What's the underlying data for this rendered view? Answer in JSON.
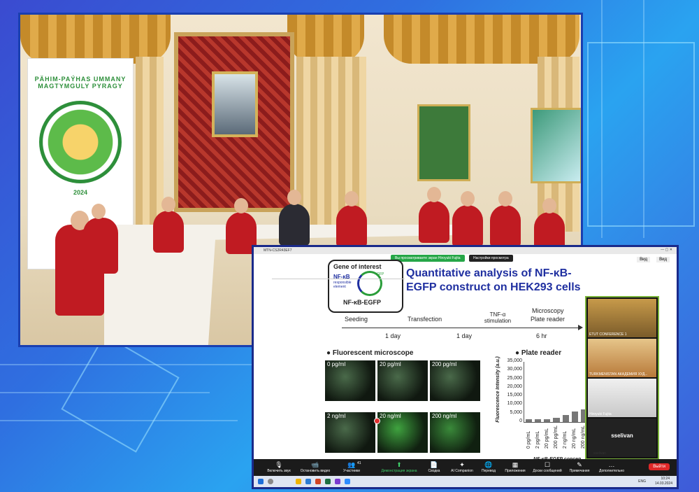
{
  "banner": {
    "text": "PÄHIM-PAÝHAS UMMANY MAGTYMGULY PYRAGY",
    "year": "2024"
  },
  "zoom": {
    "window_title": "MTN-CS2R43EF7",
    "share_banner": "Вы просматриваете экран Hiroyuki Fujita",
    "view_options": "Настройки просмотра",
    "top_right_buttons": [
      "Вид",
      "Вид"
    ]
  },
  "slide": {
    "title": "Quantitative analysis of NF-κB-EGFP construct on HEK293 cells",
    "gene_box": {
      "gene_of_interest": "Gene of interest",
      "nfkb": "NF-κB",
      "responsible": "responsible",
      "element": "element",
      "gfp": "GFP",
      "construct": "NF-κB-EGFP"
    },
    "timeline": {
      "steps": [
        "Seeding",
        "Transfection",
        "TNF-α stimulation",
        "Microscopy",
        "Plate reader"
      ],
      "intervals": [
        "1 day",
        "1 day",
        "6 hr"
      ]
    },
    "fluorescent": {
      "heading": "Fluorescent microscope",
      "labels": [
        "0 pg/ml",
        "20 pg/ml",
        "200 pg/ml",
        "2 ng/ml",
        "20 ng/ml",
        "200 ng/ml"
      ]
    },
    "plate_reader": {
      "heading": "Plate reader"
    }
  },
  "chart_data": {
    "type": "bar",
    "title": "",
    "xlabel": "NF-κB-EGFP concen",
    "ylabel": "Fluorescence Intensity (a.u.)",
    "categories": [
      "0 pg/mL",
      "2 pg/mL",
      "20 pg/mL",
      "200 pg/mL",
      "2 ng/mL",
      "20 ng/mL",
      "200 ng/mL"
    ],
    "values": [
      1500,
      1800,
      1600,
      2600,
      4000,
      6200,
      7500
    ],
    "yticks": [
      "35,000",
      "30,000",
      "25,000",
      "20,000",
      "15,000",
      "10,000",
      "5,000",
      "0"
    ],
    "ylim": [
      0,
      35000
    ]
  },
  "gallery": {
    "tiles": [
      "ETUT CONFERENCE 1",
      "TURKMENISTAN АКАДЕМИЯ ХУД...",
      "Hiroyuki Fujita"
    ],
    "self_name": "sselivan",
    "footer_name": "sselivan"
  },
  "toolbar": {
    "items": [
      {
        "icon": "🎙",
        "label": "Включить звук"
      },
      {
        "icon": "📹",
        "label": "Остановить видео"
      },
      {
        "icon": "👥",
        "label": "Участники",
        "count": "41"
      },
      {
        "icon": "⬆",
        "label": "Демонстрация экрана"
      },
      {
        "icon": "📄",
        "label": "Сводка"
      },
      {
        "icon": "✦",
        "label": "AI Companion"
      },
      {
        "icon": "🌐",
        "label": "Перевод"
      },
      {
        "icon": "▦",
        "label": "Приложения"
      },
      {
        "icon": "☐",
        "label": "Доски сообщений"
      },
      {
        "icon": "✎",
        "label": "Примечания"
      },
      {
        "icon": "…",
        "label": "Дополнительно"
      }
    ],
    "leave": "Выйти"
  },
  "taskbar": {
    "lang": "ENG",
    "time": "10:24",
    "date": "14.03.2024"
  }
}
